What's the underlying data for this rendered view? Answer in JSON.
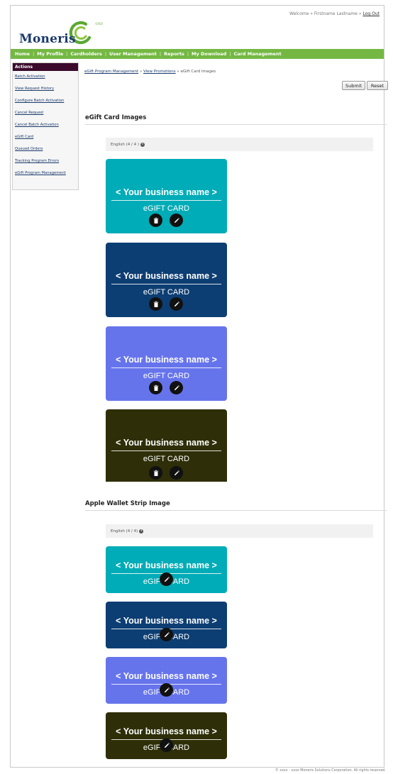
{
  "header": {
    "welcome_text": "Welcome » Firstname Lastname »",
    "logout_label": "Log Out",
    "logo_text": "Moneris",
    "logo_mark": "©ISO"
  },
  "nav": {
    "items": [
      "Home",
      "My Profile",
      "Cardholders",
      "User Management",
      "Reports",
      "My Download",
      "Card Management"
    ],
    "separator": "|"
  },
  "sidebar": {
    "title": "Actions",
    "links": [
      "Batch Activation",
      "View Request History",
      "Configure Batch Activation",
      "Cancel Request",
      "Cancel Batch Activation",
      "eGift Card",
      "Queued Orders",
      "Tracking Program Errors",
      "eGift Program Management"
    ]
  },
  "breadcrumb": {
    "link1": "eGift Program Management",
    "link2": "View Promotions",
    "sep": " » ",
    "current": "eGift Card Images"
  },
  "toolbar": {
    "submit_label": "Submit",
    "reset_label": "Reset"
  },
  "sections": {
    "egift": {
      "title": "eGift Card Images",
      "lang_label": "English (4 / 4 )",
      "info": "i"
    },
    "apple": {
      "title": "Apple Wallet Strip Image",
      "lang_label": "English (4 / 4)",
      "info": "i"
    }
  },
  "card_text": {
    "business": "< Your business name >",
    "egift": "eGIFT CARD"
  },
  "card_colors": [
    "#00acb7",
    "#0d3e73",
    "#6674ec",
    "#2e2f08"
  ],
  "icons": {
    "delete": "trash-icon",
    "edit": "pencil-icon"
  },
  "footer": {
    "copyright": "© xxxx - xxxx   Moneris Solutions Corporation. All rights reserved."
  }
}
